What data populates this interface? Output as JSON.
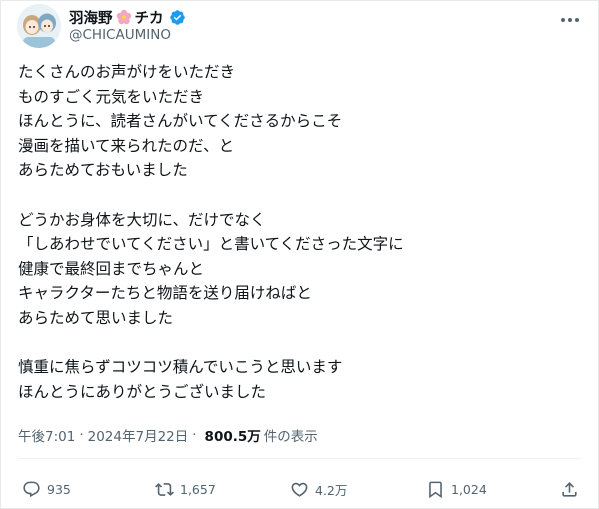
{
  "author": {
    "display_name": "羽海野",
    "display_name_suffix": "チカ",
    "handle": "@CHICAUMINO",
    "verified": true
  },
  "post": {
    "paragraphs": [
      [
        "たくさんのお声がけをいただき",
        "ものすごく元気をいただき",
        "ほんとうに、読者さんがいてくださるからこそ",
        "漫画を描いて来られたのだ、と",
        "あらためておもいました"
      ],
      [
        "どうかお身体を大切に、だけでなく",
        "「しあわせでいてください」と書いてくださった文字に",
        "健康で最終回までちゃんと",
        "キャラクターたちと物語を送り届けねばと",
        "あらためて思いました"
      ],
      [
        "慎重に焦らずコツコツ積んでいこうと思います",
        "ほんとうにありがとうございました"
      ]
    ],
    "time": "午後7:01",
    "separator": "·",
    "date": "2024年7月22日",
    "views_count": "800.5万",
    "views_label": "件の表示"
  },
  "actions": {
    "replies": "935",
    "reposts": "1,657",
    "likes": "4.2万",
    "bookmarks": "1,024"
  },
  "icons": {
    "verified_color": "#1d9bf0",
    "flower_color": "#f4a7c0",
    "icon_color": "#536471"
  }
}
